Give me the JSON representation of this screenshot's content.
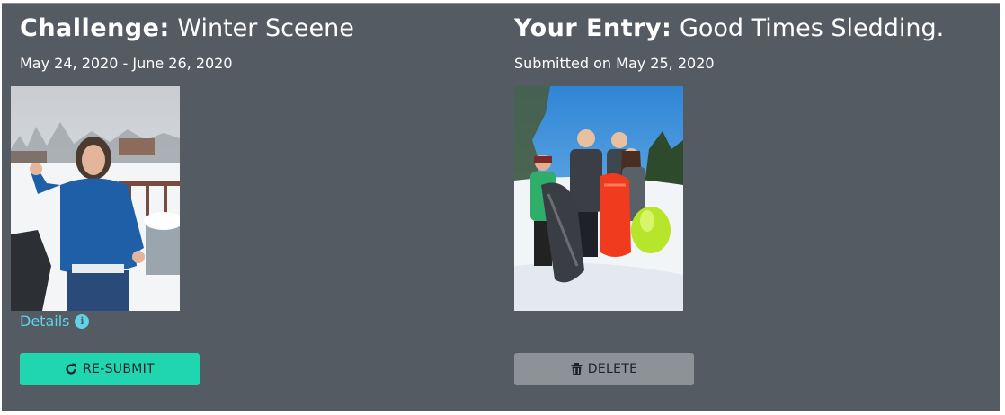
{
  "challenge": {
    "title_key": "Challenge:",
    "title_value": "Winter Sceene",
    "date_range": "May 24, 2020 - June 26, 2020",
    "details_label": "Details",
    "info_icon": "info-circle-icon",
    "resubmit_label": "RE-SUBMIT",
    "resubmit_icon": "refresh-icon"
  },
  "entry": {
    "title_key": "Your Entry:",
    "title_value": "Good Times Sledding.",
    "submitted_text": "Submitted on May 25, 2020",
    "delete_label": "DELETE",
    "delete_icon": "trash-icon"
  },
  "colors": {
    "panel": "#555b62",
    "accent": "#1fd6b0",
    "link": "#5fd3e8",
    "delete_button": "#8d9297"
  }
}
